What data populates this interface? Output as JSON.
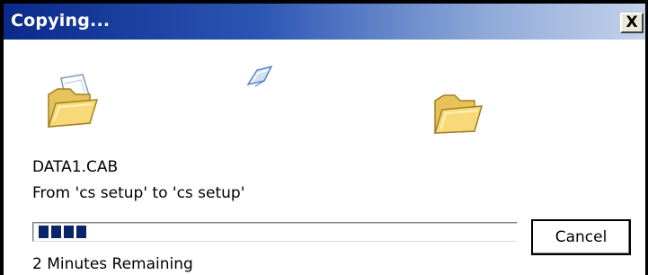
{
  "window": {
    "title": "Copying...",
    "close_glyph": "X"
  },
  "icons": {
    "source": "open-folder-icon",
    "flying": "flying-document-icon",
    "destination": "open-folder-icon"
  },
  "file": {
    "name": "DATA1.CAB",
    "from_to": "From 'cs setup' to 'cs setup'"
  },
  "progress": {
    "fraction": 0.11,
    "visible_blocks": 4,
    "color": "#0a246a"
  },
  "status": {
    "remaining": "2 Minutes Remaining"
  },
  "buttons": {
    "cancel": "Cancel"
  },
  "colors": {
    "titlebar_start": "#0a2a8a",
    "titlebar_end": "#c4d2ea"
  }
}
